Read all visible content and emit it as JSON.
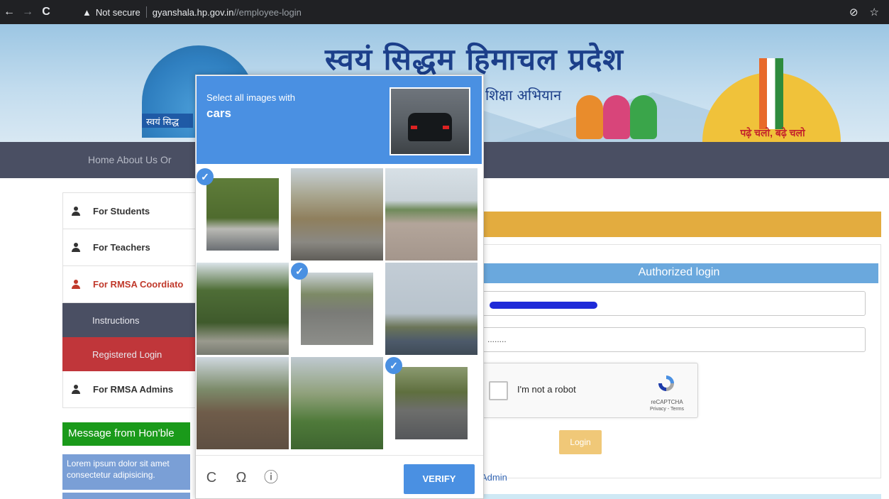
{
  "browser": {
    "back": "←",
    "forward": "→",
    "reload": "C",
    "security_icon": "warning-triangle-icon",
    "not_secure": "Not secure",
    "url_host": "gyanshala.hp.gov.in",
    "url_path": "//employee-login",
    "eye_off_icon": "⊘",
    "star_icon": "☆"
  },
  "banner": {
    "title": "स्वयं सिद्धम हिमाचल प्रदेश",
    "subtitle": "शिक्षा अभियान",
    "left_logo_text": "स्वयं सिद्ध",
    "right_logo_motto": "पढ़े चलो, बढ़े चलो"
  },
  "nav": {
    "links": "Home  About Us  Or"
  },
  "sidebar": {
    "items": [
      {
        "label": "For Students"
      },
      {
        "label": "For Teachers"
      },
      {
        "label": "For RMSA Coordiato"
      }
    ],
    "sub_items": [
      {
        "label": "Instructions"
      },
      {
        "label": "Registered Login"
      }
    ],
    "admins": {
      "label": "For RMSA Admins"
    }
  },
  "message": {
    "header": "Message from Hon'ble",
    "body": "Lorem ipsum dolor sit amet consectetur adipisicing."
  },
  "login": {
    "header": "Authorized login",
    "email_value": "",
    "password_value": "........",
    "button": "Login",
    "admin_link": "Admin"
  },
  "recaptcha": {
    "checkbox_label": "I'm not a robot",
    "brand": "reCAPTCHA",
    "terms": "Privacy - Terms"
  },
  "challenge": {
    "prompt": "Select all images with",
    "target": "cars",
    "verify_label": "VERIFY",
    "reload_icon": "C",
    "audio_icon": "Ω",
    "info_icon": "ⓘ",
    "tiles": [
      {
        "selected": true
      },
      {
        "selected": false
      },
      {
        "selected": false
      },
      {
        "selected": false
      },
      {
        "selected": true
      },
      {
        "selected": false
      },
      {
        "selected": false
      },
      {
        "selected": false
      },
      {
        "selected": true
      }
    ]
  },
  "colors": {
    "challenge_blue": "#4a90e2",
    "nav_bg": "#4a4f63",
    "accent_orange": "#e3ac3f",
    "registered_red": "#c0363a",
    "message_green": "#1a9a1a"
  }
}
